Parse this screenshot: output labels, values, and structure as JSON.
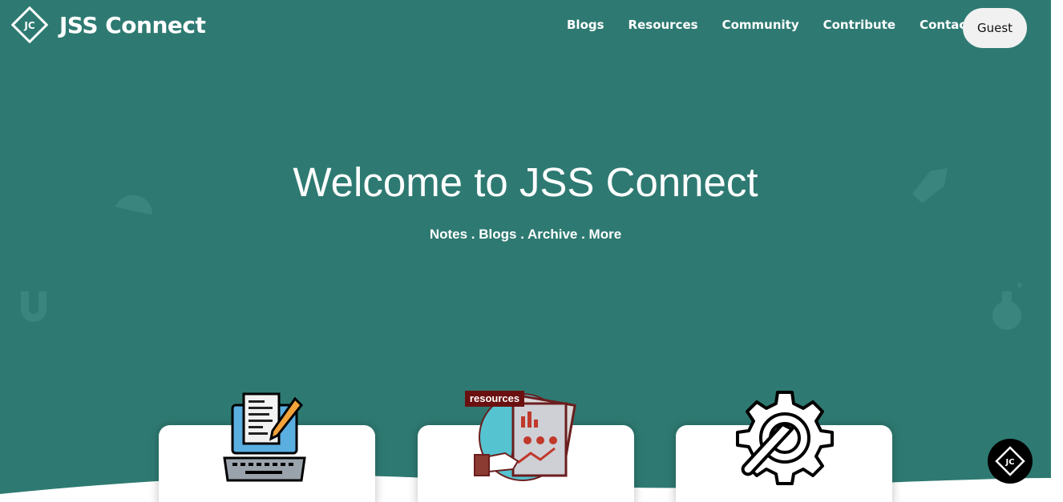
{
  "brand": {
    "logo_text": "JC",
    "name": "JSS Connect"
  },
  "nav": {
    "items": [
      {
        "label": "Blogs"
      },
      {
        "label": "Resources"
      },
      {
        "label": "Community"
      },
      {
        "label": "Contribute"
      },
      {
        "label": "Contact"
      }
    ],
    "user_button": "Guest"
  },
  "hero": {
    "title": "Welcome to JSS Connect",
    "subtitle": "Notes . Blogs . Archive . More"
  },
  "cards": [
    {
      "icon": "laptop-notes-icon"
    },
    {
      "icon": "resources-report-icon",
      "badge": "resources"
    },
    {
      "icon": "gear-wrench-icon"
    }
  ],
  "fab": {
    "icon": "jc-logo-icon",
    "logo_text": "JC"
  },
  "colors": {
    "hero_bg": "#2e7a72",
    "guest_bg": "#f1f1f1",
    "fab_bg": "#000000"
  }
}
